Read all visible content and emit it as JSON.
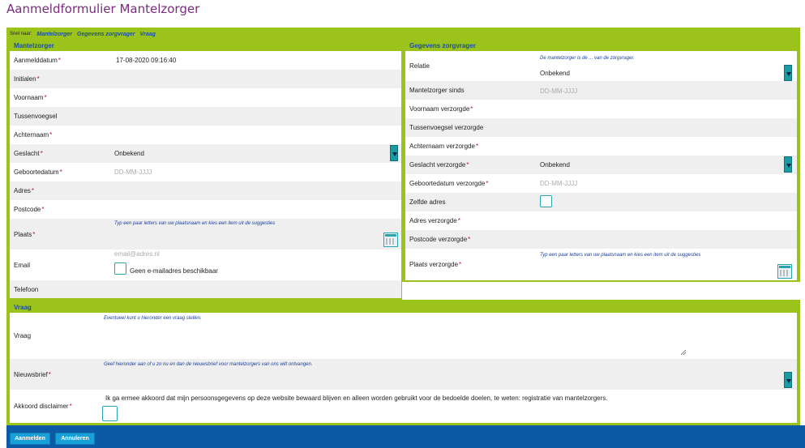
{
  "page": {
    "title": "Aanmeldformulier Mantelzorger"
  },
  "quicknav": {
    "label": "Snel naar:",
    "links": [
      "Mantelzorger",
      "Gegevens zorgvrager",
      "Vraag"
    ]
  },
  "mantelzorger": {
    "header": "Mantelzorger",
    "aanmelddatum": {
      "label": "Aanmelddatum",
      "value": "17-08-2020 09:16:40"
    },
    "initialen": {
      "label": "Initialen"
    },
    "voornaam": {
      "label": "Voornaam"
    },
    "tussenvoegsel": {
      "label": "Tussenvoegsel"
    },
    "achternaam": {
      "label": "Achternaam"
    },
    "geslacht": {
      "label": "Geslacht",
      "value": "Onbekend"
    },
    "geboortedatum": {
      "label": "Geboortedatum",
      "placeholder": "DD-MM-JJJJ"
    },
    "adres": {
      "label": "Adres"
    },
    "postcode": {
      "label": "Postcode"
    },
    "plaats": {
      "label": "Plaats",
      "hint": "Typ een paar letters van uw plaatsnaam en kies een item uit de suggesties"
    },
    "email": {
      "label": "Email",
      "placeholder": "email@adres.nl",
      "checkbox_label": "Geen e-mailadres beschikbaar"
    },
    "telefoon": {
      "label": "Telefoon"
    }
  },
  "zorgvrager": {
    "header": "Gegevens zorgvrager",
    "relatie": {
      "label": "Relatie",
      "hint": "De mantelzorger is de ... van de zorgvrager.",
      "value": "Onbekend"
    },
    "sinds": {
      "label": "Mantelzorger sinds",
      "placeholder": "DD-MM-JJJJ"
    },
    "voornaam": {
      "label": "Voornaam verzorgde"
    },
    "tussenvoegsel": {
      "label": "Tussenvoegsel verzorgde"
    },
    "achternaam": {
      "label": "Achternaam verzorgde"
    },
    "geslacht": {
      "label": "Geslacht verzorgde",
      "value": "Onbekend"
    },
    "geboortedatum": {
      "label": "Geboortedatum verzorgde",
      "placeholder": "DD-MM-JJJJ"
    },
    "zelfde_adres": {
      "label": "Zelfde adres"
    },
    "adres": {
      "label": "Adres verzorgde"
    },
    "postcode": {
      "label": "Postcode verzorgde"
    },
    "plaats": {
      "label": "Plaats verzorgde",
      "hint": "Typ een paar letters van uw plaatsnaam en kies een item uit de suggesties"
    }
  },
  "vraag": {
    "header": "Vraag",
    "vraag": {
      "label": "Vraag",
      "hint": "Eventueel kunt u hieronder een vraag stellen."
    },
    "nieuwsbrief": {
      "label": "Nieuwsbrief",
      "hint": "Geef hieronder aan of u zo nu en dan de nieuwsbrief voor mantelzorgers van ons wilt ontvangen."
    },
    "akkoord": {
      "label": "Akkoord disclaimer",
      "text": "Ik ga ermee akkoord dat mijn persoonsgegevens op deze website bewaard blijven en alleen worden gebruikt voor de bedoelde doelen, te weten: registratie van mantelzorgers."
    }
  },
  "actions": {
    "submit": "Aanmelden",
    "cancel": "Annuleren"
  },
  "required_mark": "*",
  "colors": {
    "accent_green": "#9bc31c",
    "title_purple": "#7b2a7e",
    "footer_blue": "#0c5aa6",
    "button_blue": "#1aa0d8",
    "select_teal": "#1a9aa3"
  }
}
